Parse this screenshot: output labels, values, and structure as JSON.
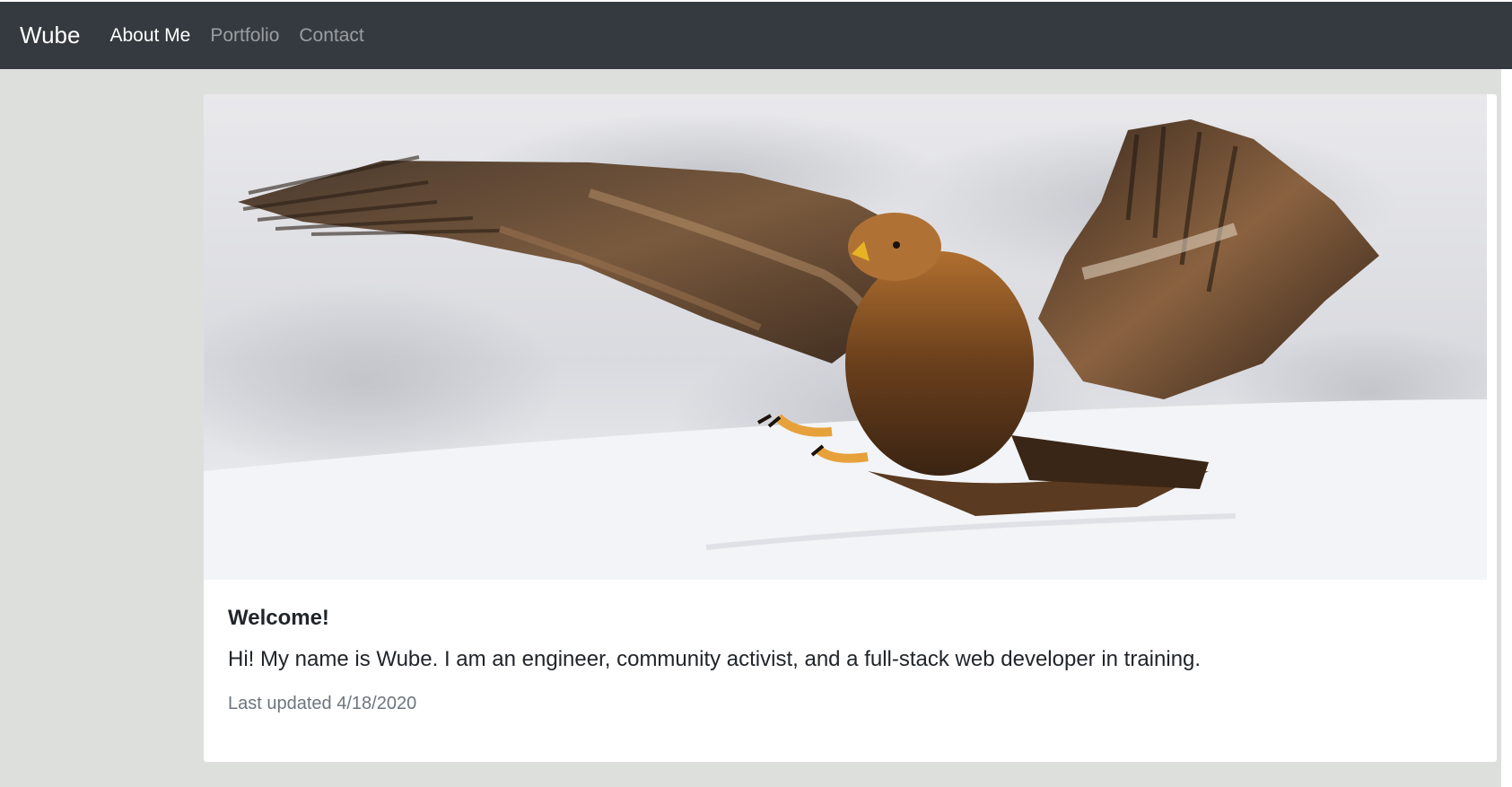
{
  "navbar": {
    "brand": "Wube",
    "links": [
      {
        "label": "About Me",
        "active": true
      },
      {
        "label": "Portfolio",
        "active": false
      },
      {
        "label": "Contact",
        "active": false
      }
    ]
  },
  "card": {
    "image_alt": "eagle-photo",
    "title": "Welcome!",
    "text": "Hi! My name is Wube. I am an engineer, community activist, and a full-stack web developer in training.",
    "updated": "Last updated 4/18/2020"
  },
  "colors": {
    "navbar_bg": "#343a40",
    "page_bg": "#dcdfdb",
    "muted_text": "#6c757d"
  }
}
